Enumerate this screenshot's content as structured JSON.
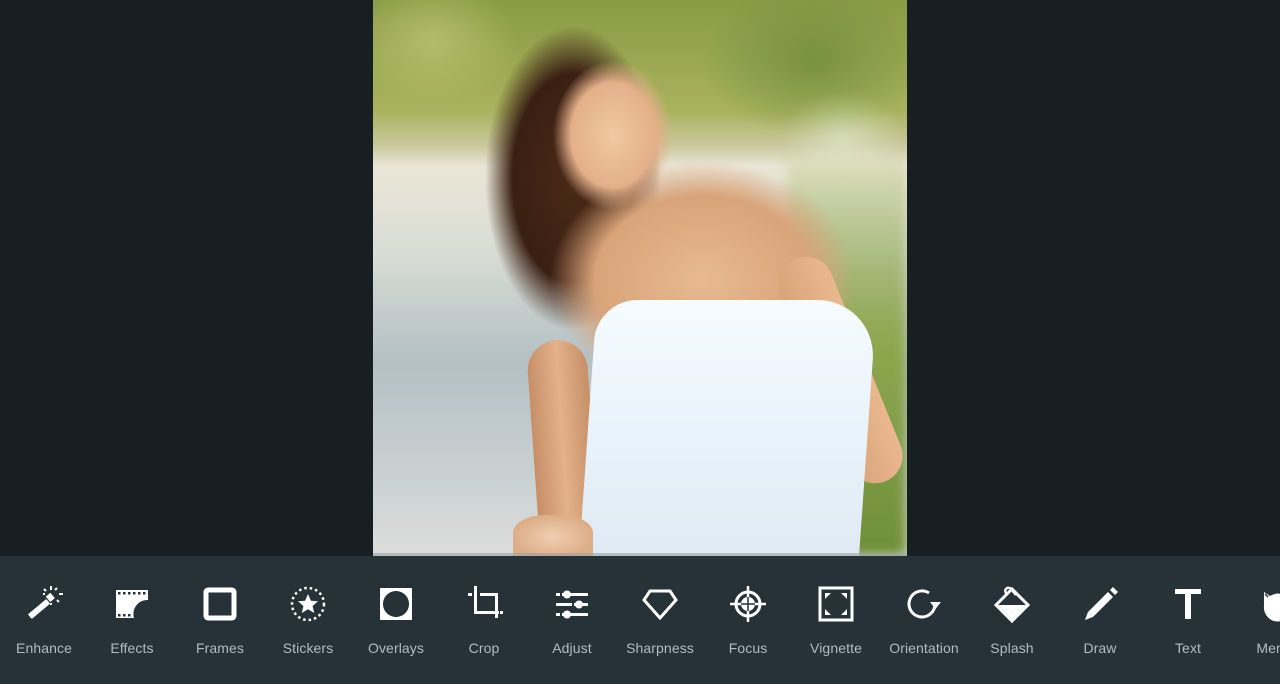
{
  "canvas": {
    "photo_description": "Smiling woman with long brown wavy hair in a white strapless top, outdoors with blurred green trees"
  },
  "colors": {
    "workspace_bg": "#181f23",
    "toolbar_bg": "#263238",
    "icon_color": "#ffffff",
    "label_color": "#b0bcc2"
  },
  "toolbar": {
    "tools": [
      {
        "label": "Enhance",
        "icon": "magic-wand-icon"
      },
      {
        "label": "Effects",
        "icon": "film-strip-icon"
      },
      {
        "label": "Frames",
        "icon": "frame-square-icon"
      },
      {
        "label": "Stickers",
        "icon": "star-sticker-icon"
      },
      {
        "label": "Overlays",
        "icon": "overlay-circle-icon"
      },
      {
        "label": "Crop",
        "icon": "crop-icon"
      },
      {
        "label": "Adjust",
        "icon": "sliders-icon"
      },
      {
        "label": "Sharpness",
        "icon": "diamond-icon"
      },
      {
        "label": "Focus",
        "icon": "crosshair-icon"
      },
      {
        "label": "Vignette",
        "icon": "vignette-icon"
      },
      {
        "label": "Orientation",
        "icon": "rotate-icon"
      },
      {
        "label": "Splash",
        "icon": "paint-bucket-icon"
      },
      {
        "label": "Draw",
        "icon": "pencil-icon"
      },
      {
        "label": "Text",
        "icon": "text-t-icon"
      },
      {
        "label": "Meme",
        "icon": "cat-face-icon"
      }
    ]
  }
}
